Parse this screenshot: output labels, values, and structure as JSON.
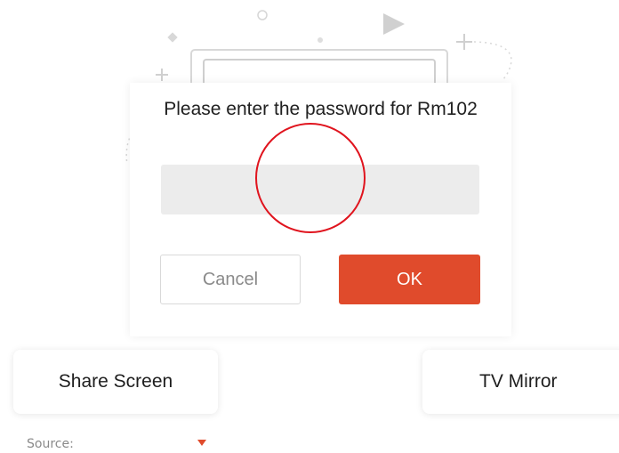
{
  "dialog": {
    "title": "Please enter the password for Rm102",
    "password_value": "",
    "password_placeholder": "",
    "cancel_label": "Cancel",
    "ok_label": "OK"
  },
  "modes": {
    "share_screen_label": "Share Screen",
    "tv_mirror_label": "TV Mirror"
  },
  "source": {
    "label": "Source:",
    "selected_value": ""
  },
  "icons": {
    "dropdown": "caret-down-icon",
    "illustration": "monitor-illustration-icon"
  },
  "colors": {
    "accent": "#e04b2c",
    "annotation": "#e0141e",
    "input_background": "#ececec"
  }
}
